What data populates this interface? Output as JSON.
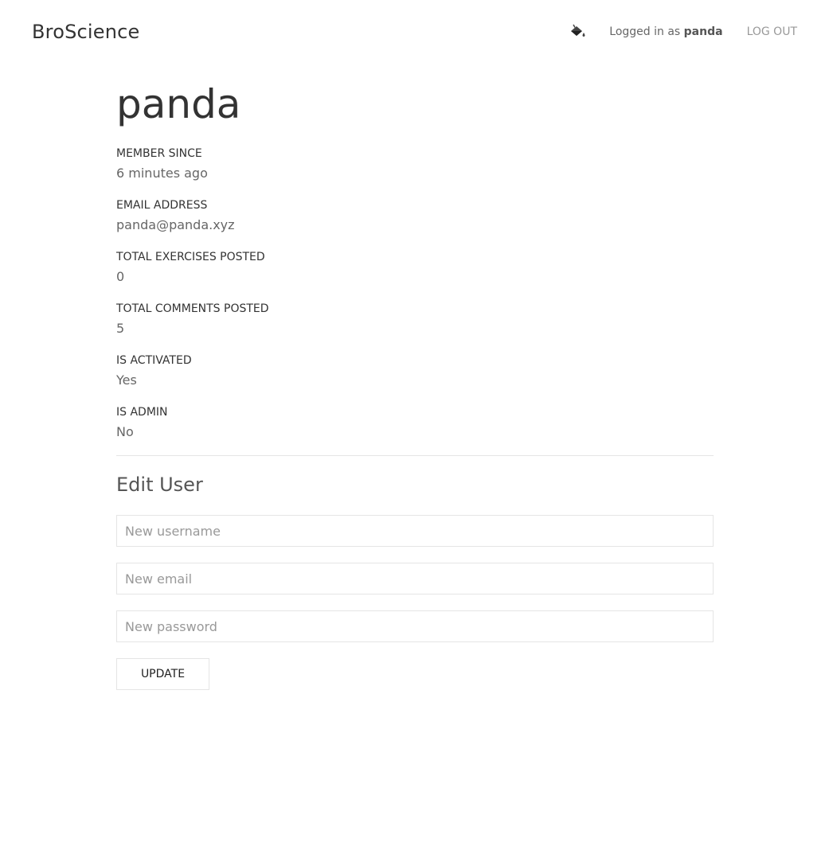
{
  "header": {
    "brand": "BroScience",
    "theme_icon": "paint-bucket-icon",
    "logged_in_prefix": "Logged in as",
    "logged_in_user": "panda",
    "logout_label": "LOG OUT"
  },
  "profile": {
    "username": "panda",
    "fields": [
      {
        "label": "MEMBER SINCE",
        "value": "6 minutes ago"
      },
      {
        "label": "EMAIL ADDRESS",
        "value": "panda@panda.xyz"
      },
      {
        "label": "TOTAL EXERCISES POSTED",
        "value": "0"
      },
      {
        "label": "TOTAL COMMENTS POSTED",
        "value": "5"
      },
      {
        "label": "IS ACTIVATED",
        "value": "Yes"
      },
      {
        "label": "IS ADMIN",
        "value": "No"
      }
    ]
  },
  "edit": {
    "title": "Edit User",
    "username_placeholder": "New username",
    "email_placeholder": "New email",
    "password_placeholder": "New password",
    "username_value": "",
    "email_value": "",
    "password_value": "",
    "submit_label": "UPDATE"
  }
}
